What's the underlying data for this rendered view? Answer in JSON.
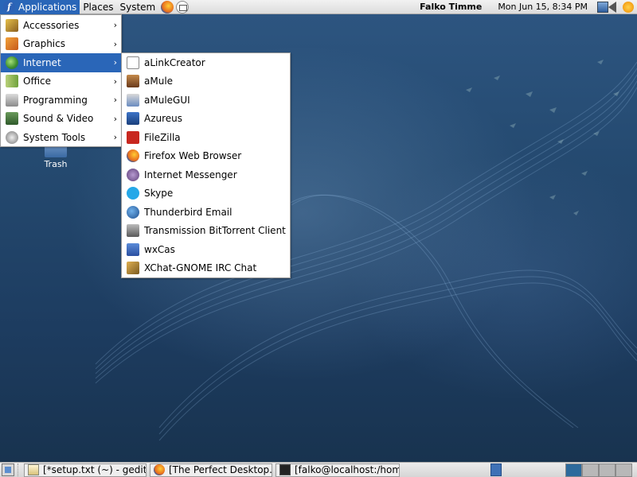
{
  "top_panel": {
    "menus": [
      "Applications",
      "Places",
      "System"
    ],
    "launchers": [
      "firefox-icon",
      "mail-icon"
    ],
    "user": "Falko Timme",
    "clock": "Mon Jun 15,  8:34 PM",
    "tray": [
      "network-icon",
      "volume-icon",
      "update-icon"
    ]
  },
  "applications_menu": {
    "items": [
      {
        "label": "Accessories",
        "icon": "accessories-icon"
      },
      {
        "label": "Graphics",
        "icon": "graphics-icon"
      },
      {
        "label": "Internet",
        "icon": "internet-icon"
      },
      {
        "label": "Office",
        "icon": "office-icon"
      },
      {
        "label": "Programming",
        "icon": "programming-icon"
      },
      {
        "label": "Sound & Video",
        "icon": "sound-video-icon"
      },
      {
        "label": "System Tools",
        "icon": "system-tools-icon"
      }
    ],
    "active_item": "Internet",
    "arrow": "›"
  },
  "internet_submenu": {
    "items": [
      {
        "label": "aLinkCreator",
        "icon": "alinkcreator-icon"
      },
      {
        "label": "aMule",
        "icon": "amule-icon"
      },
      {
        "label": "aMuleGUI",
        "icon": "amulegui-icon"
      },
      {
        "label": "Azureus",
        "icon": "azureus-icon"
      },
      {
        "label": "FileZilla",
        "icon": "filezilla-icon"
      },
      {
        "label": "Firefox Web Browser",
        "icon": "firefox-icon"
      },
      {
        "label": "Internet Messenger",
        "icon": "messenger-icon"
      },
      {
        "label": "Skype",
        "icon": "skype-icon"
      },
      {
        "label": "Thunderbird Email",
        "icon": "thunderbird-icon"
      },
      {
        "label": "Transmission BitTorrent Client",
        "icon": "transmission-icon"
      },
      {
        "label": "wxCas",
        "icon": "wxcas-icon"
      },
      {
        "label": "XChat-GNOME IRC Chat",
        "icon": "xchat-icon"
      }
    ]
  },
  "desktop": {
    "trash_label": "Trash"
  },
  "bottom_panel": {
    "tasks": [
      {
        "label": "[*setup.txt (~) - gedit]",
        "icon": "gedit-icon"
      },
      {
        "label": "[The Perfect Desktop...",
        "icon": "firefox-icon"
      },
      {
        "label": "[falko@localhost:/hom...",
        "icon": "terminal-icon"
      }
    ],
    "workspace_count": 4,
    "current_workspace": 1
  },
  "colors": {
    "selection": "#2a66b8",
    "desktop_blue": "#24496f",
    "panel_gray": "#dcdcdc"
  }
}
